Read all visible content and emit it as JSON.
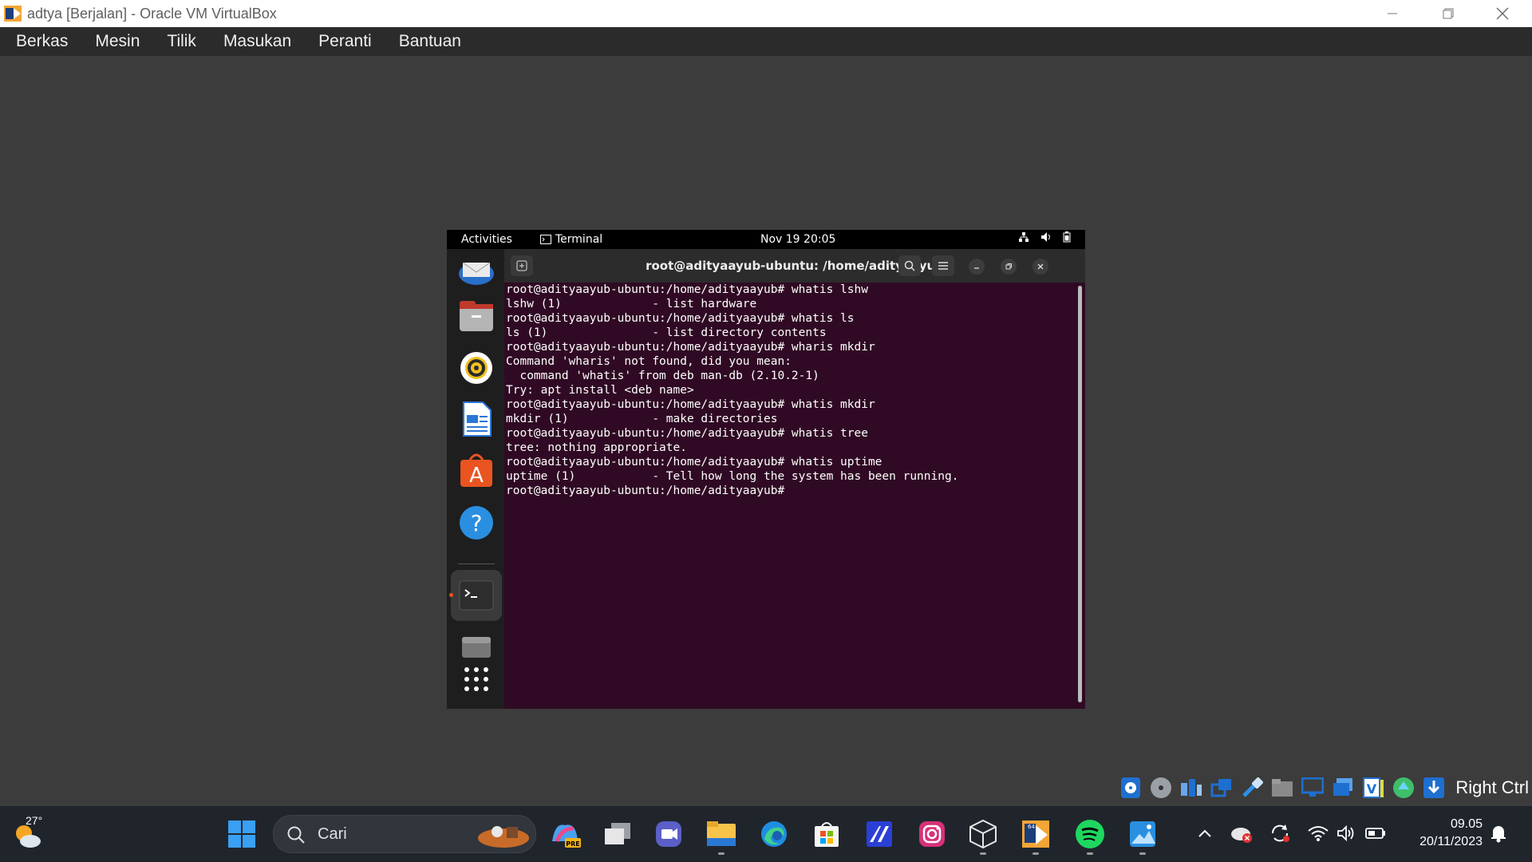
{
  "window": {
    "title": "adtya [Berjalan] - Oracle VM VirtualBox",
    "controls": [
      "minimize-icon",
      "restore-icon",
      "close-icon"
    ]
  },
  "menubar": {
    "items": [
      "Berkas",
      "Mesin",
      "Tilik",
      "Masukan",
      "Peranti",
      "Bantuan"
    ]
  },
  "guest": {
    "topbar": {
      "activities": "Activities",
      "app": "Terminal",
      "clock": "Nov 19  20:05"
    },
    "dock": [
      "thunderbird-icon",
      "files-icon",
      "rhythmbox-icon",
      "writer-icon",
      "software-icon",
      "help-icon",
      "terminal-icon",
      "trash-icon",
      "apps-grid-icon"
    ],
    "terminal": {
      "title": "root@adityaayub-ubuntu: /home/adityaayub",
      "lines": [
        "root@adityaayub-ubuntu:/home/adityaayub# whatis lshw",
        "lshw (1)             - list hardware",
        "root@adityaayub-ubuntu:/home/adityaayub# whatis ls",
        "ls (1)               - list directory contents",
        "root@adityaayub-ubuntu:/home/adityaayub# wharis mkdir",
        "Command 'wharis' not found, did you mean:",
        "  command 'whatis' from deb man-db (2.10.2-1)",
        "Try: apt install <deb name>",
        "root@adityaayub-ubuntu:/home/adityaayub# whatis mkdir",
        "mkdir (1)            - make directories",
        "root@adityaayub-ubuntu:/home/adityaayub# whatis tree",
        "tree: nothing appropriate.",
        "root@adityaayub-ubuntu:/home/adityaayub# whatis uptime",
        "uptime (1)           - Tell how long the system has been running.",
        "root@adityaayub-ubuntu:/home/adityaayub# "
      ]
    }
  },
  "hoststatus": {
    "icons": [
      "hdd-icon",
      "optical-icon",
      "audio-icon",
      "network-icon",
      "usb-icon",
      "shared-folder-icon",
      "display-icon",
      "recording-icon",
      "vt-x-icon",
      "mouse-integration-icon",
      "download-icon"
    ],
    "host_key": "Right Ctrl"
  },
  "taskbar": {
    "temperature": "27°",
    "search_placeholder": "Cari",
    "apps": [
      "start-icon",
      "copilot-icon",
      "task-view-icon",
      "teams-icon",
      "file-explorer-icon",
      "edge-icon",
      "store-icon",
      "app-icon",
      "instagram-icon",
      "virtualbox-icon",
      "vbox-vm-icon",
      "spotify-icon",
      "photos-icon"
    ],
    "time": "09.05",
    "date": "20/11/2023"
  },
  "colors": {
    "terminal_bg": "#300a24",
    "vm_bg": "#3c3c3c",
    "taskbar_bg": "#20252c",
    "accent": "#e95420"
  }
}
